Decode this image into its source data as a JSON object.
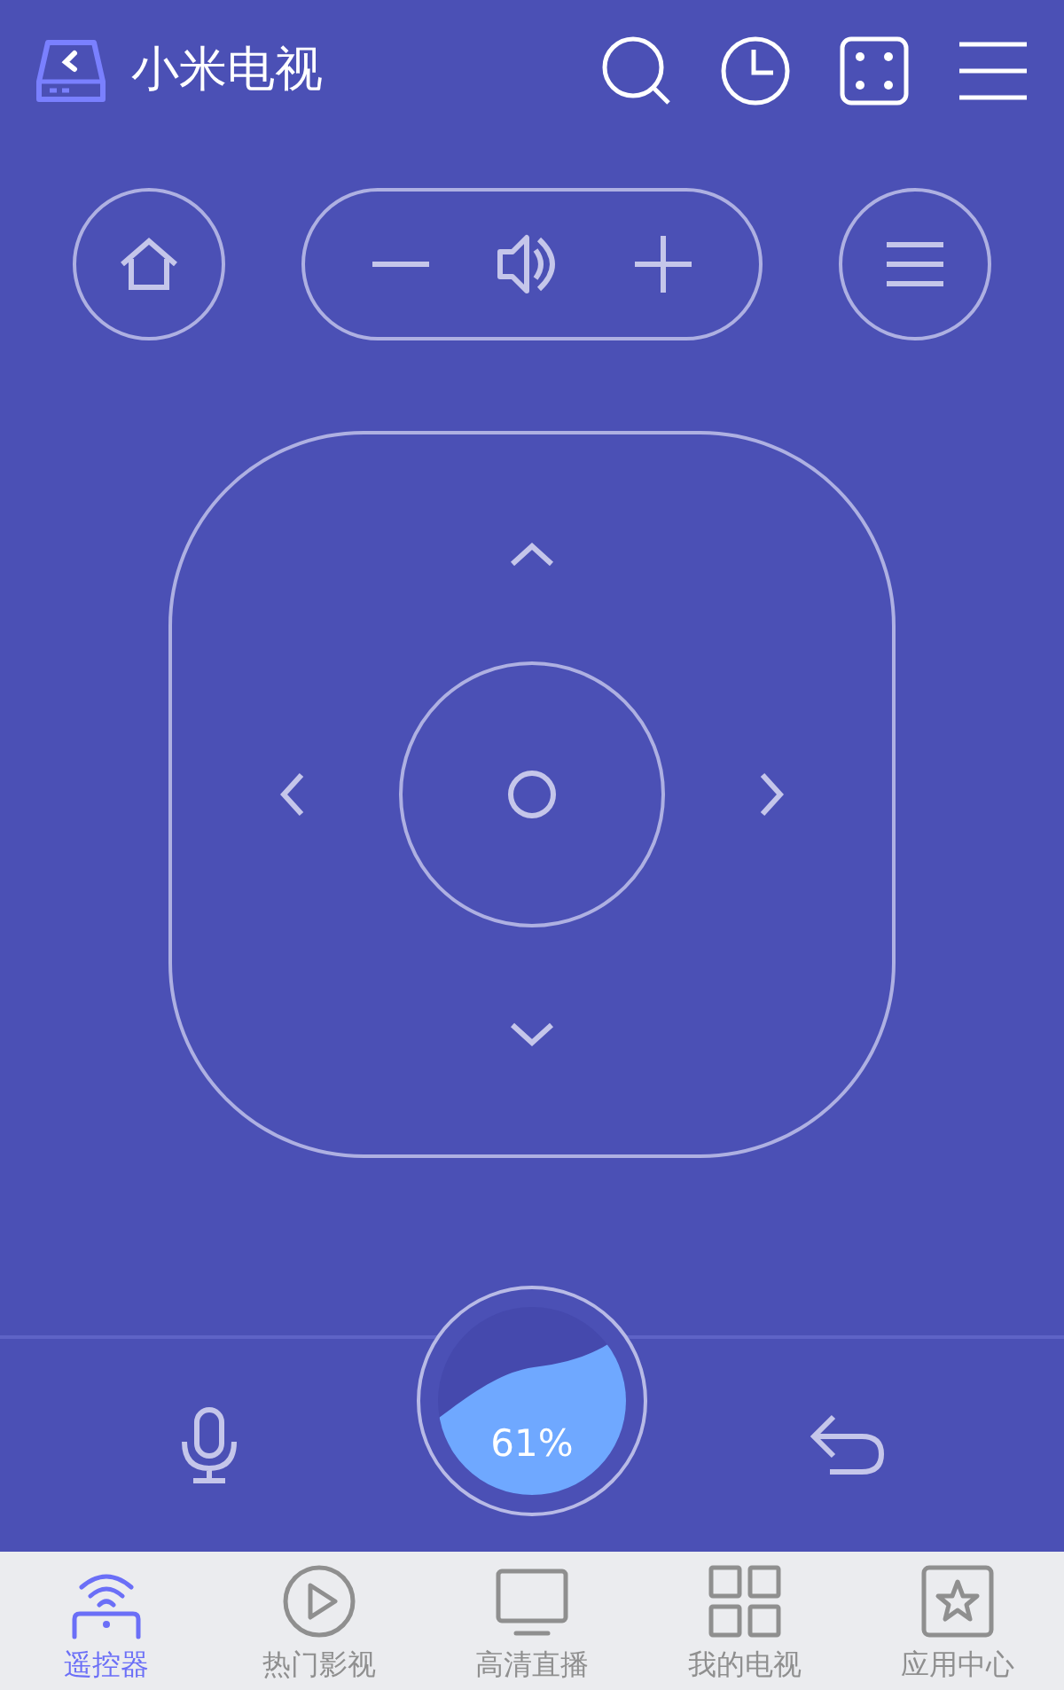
{
  "header": {
    "title": "小米电视"
  },
  "gauge": {
    "reading": "61%"
  },
  "tabs": [
    {
      "label": "遥控器",
      "selected": true,
      "kind": "remote"
    },
    {
      "label": "热门影视",
      "selected": false,
      "kind": "play"
    },
    {
      "label": "高清直播",
      "selected": false,
      "kind": "tv"
    },
    {
      "label": "我的电视",
      "selected": false,
      "kind": "grid"
    },
    {
      "label": "应用中心",
      "selected": false,
      "kind": "star"
    }
  ]
}
